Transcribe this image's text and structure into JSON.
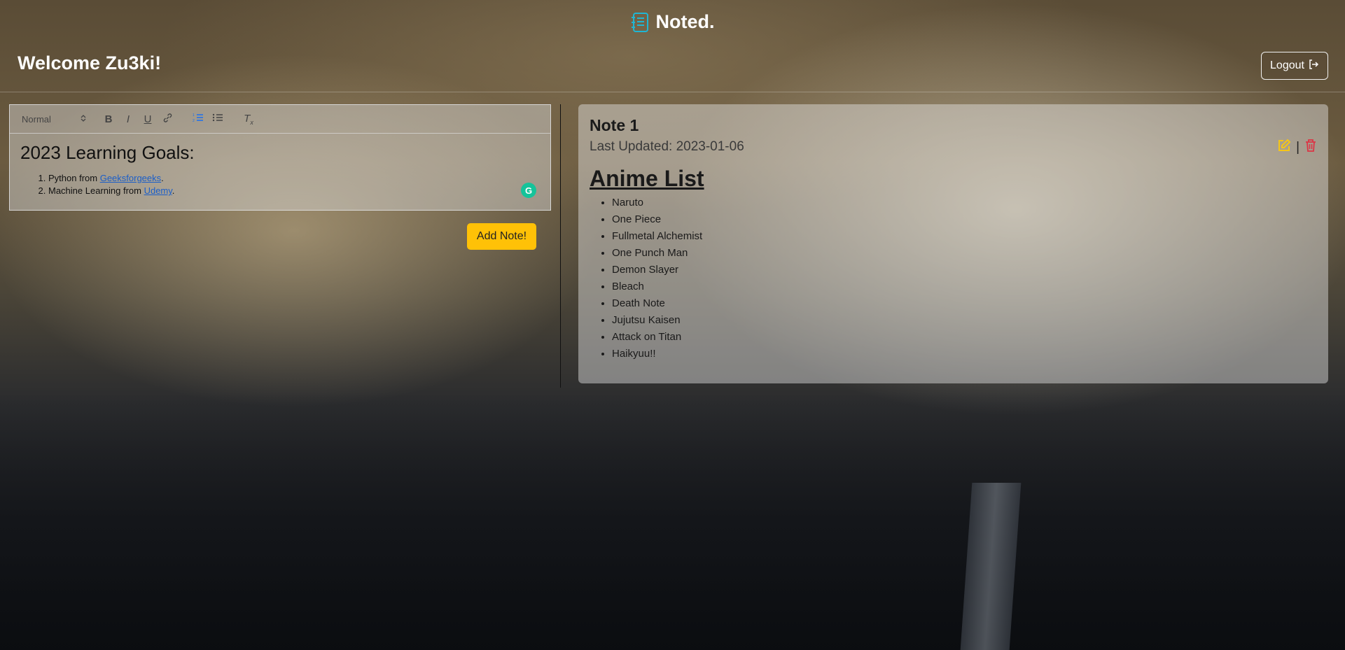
{
  "brand": {
    "name": "Noted.",
    "icon": "notebook-icon",
    "accent": "#1fb6d4"
  },
  "header": {
    "welcome": "Welcome Zu3ki!",
    "logout_label": "Logout",
    "logout_icon": "logout-icon"
  },
  "editor": {
    "toolbar": {
      "format_value": "Normal",
      "buttons": [
        "bold",
        "italic",
        "underline",
        "link",
        "ordered-list",
        "bullet-list",
        "clear-format"
      ]
    },
    "content": {
      "heading": "2023 Learning Goals:",
      "items": [
        {
          "text": "Python from ",
          "link": "Geeksforgeeks",
          "suffix": "."
        },
        {
          "text": "Machine Learning from ",
          "link": "Udemy",
          "suffix": "."
        }
      ]
    },
    "add_button_label": "Add Note!",
    "add_button_color": "#ffc107"
  },
  "notes": [
    {
      "title": "Note 1",
      "last_updated": "Last Updated: 2023-01-06",
      "heading": "Anime List",
      "items": [
        "Naruto",
        "One Piece",
        "Fullmetal Alchemist",
        "One Punch Man",
        "Demon Slayer",
        "Bleach",
        "Death Note",
        "Jujutsu Kaisen",
        "Attack on Titan",
        "Haikyuu!!"
      ],
      "edit_color": "#f5c518",
      "delete_color": "#dc3545",
      "separator": "|"
    }
  ]
}
